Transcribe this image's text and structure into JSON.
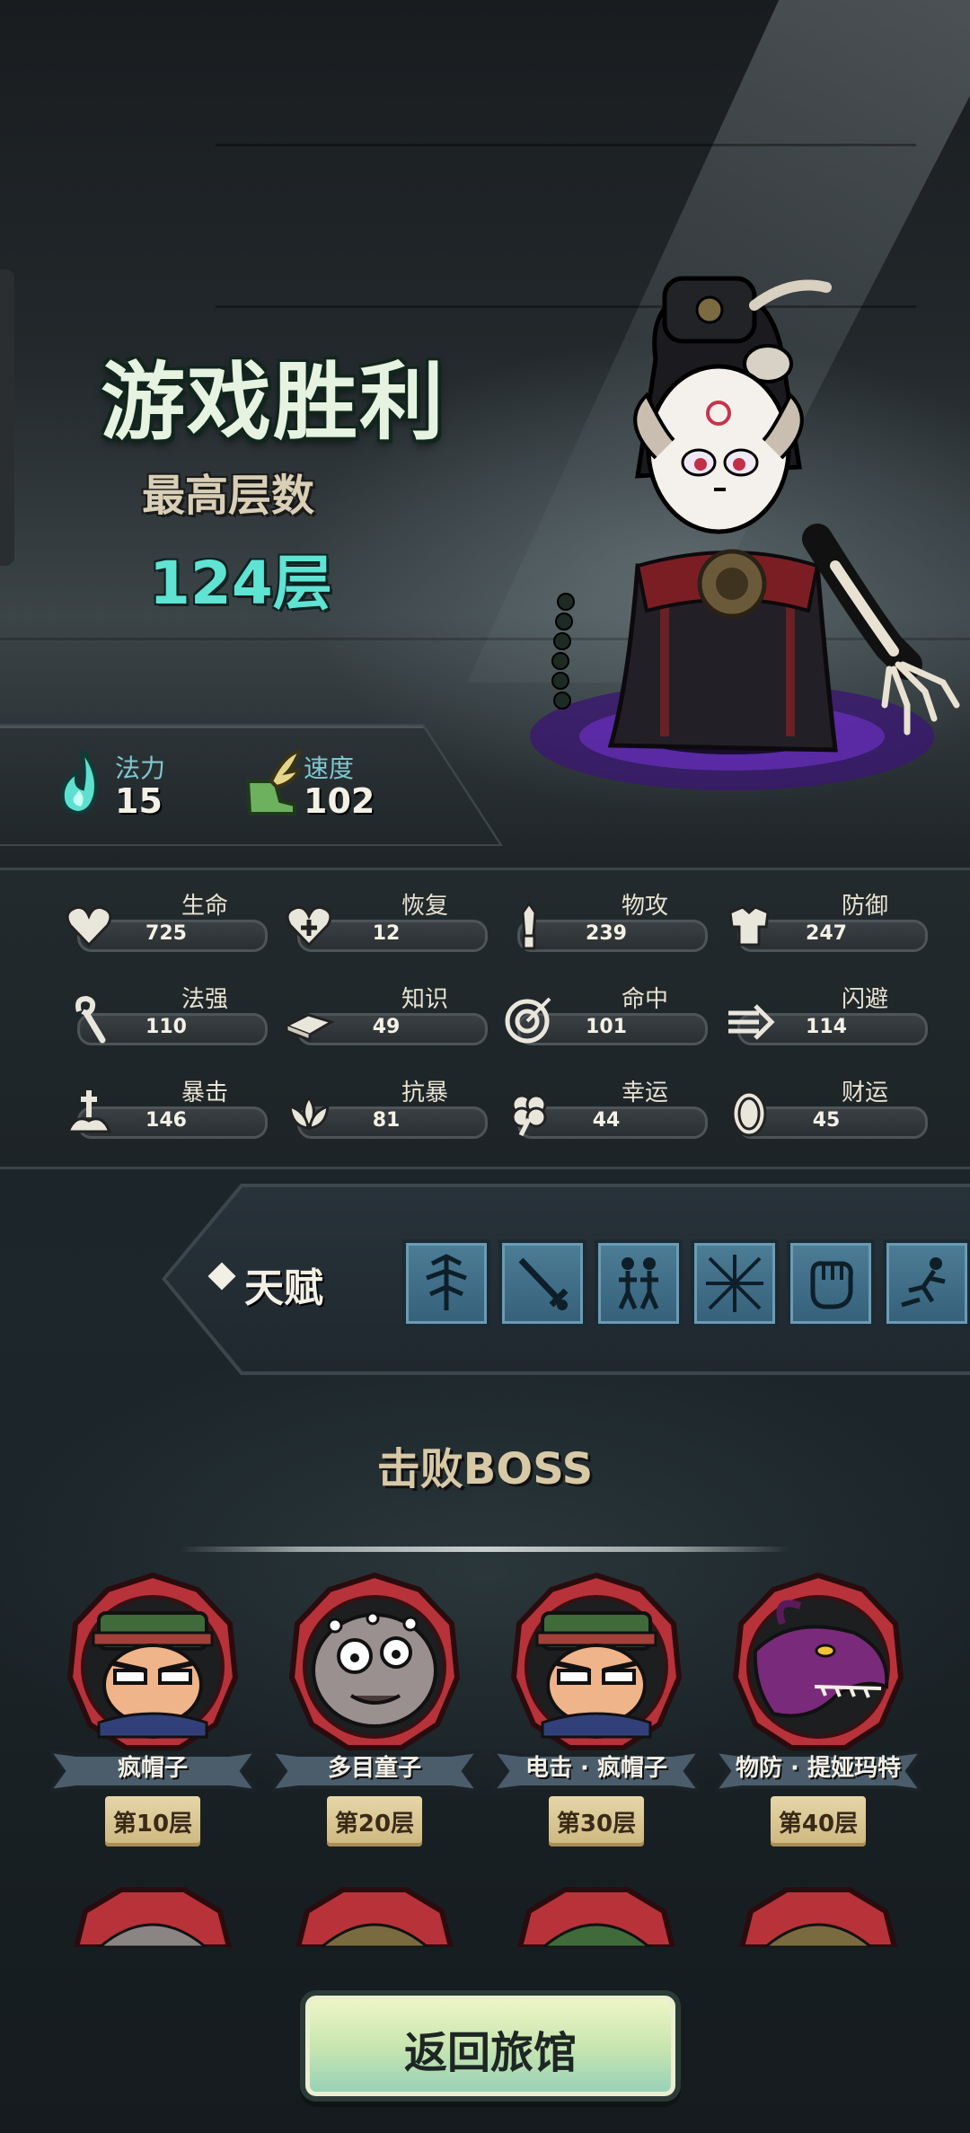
{
  "result": {
    "title": "游戏胜利",
    "floor_label": "最高层数",
    "floor_value": "124层"
  },
  "quick_stats": [
    {
      "label": "法力",
      "value": "15",
      "icon": "blue-flame-icon"
    },
    {
      "label": "速度",
      "value": "102",
      "icon": "winged-boot-icon"
    }
  ],
  "attributes": [
    {
      "name": "生命",
      "value": "725",
      "icon": "heart-icon"
    },
    {
      "name": "恢复",
      "value": "12",
      "icon": "heart-plus-icon"
    },
    {
      "name": "物攻",
      "value": "239",
      "icon": "sword-icon"
    },
    {
      "name": "防御",
      "value": "247",
      "icon": "armor-icon"
    },
    {
      "name": "法强",
      "value": "110",
      "icon": "magic-staff-icon"
    },
    {
      "name": "知识",
      "value": "49",
      "icon": "book-icon"
    },
    {
      "name": "命中",
      "value": "101",
      "icon": "target-icon"
    },
    {
      "name": "闪避",
      "value": "114",
      "icon": "dodge-arrows-icon"
    },
    {
      "name": "暴击",
      "value": "146",
      "icon": "critical-dagger-icon"
    },
    {
      "name": "抗暴",
      "value": "81",
      "icon": "lotus-shield-icon"
    },
    {
      "name": "幸运",
      "value": "44",
      "icon": "clover-icon"
    },
    {
      "name": "财运",
      "value": "45",
      "icon": "coin-icon"
    }
  ],
  "talent": {
    "label": "天赋",
    "slots": [
      "arrows-talent-icon",
      "blade-talent-icon",
      "twins-talent-icon",
      "crossed-swords-talent-icon",
      "fist-talent-icon",
      "dash-talent-icon"
    ]
  },
  "boss_section": {
    "heading": "击败BOSS",
    "bosses": [
      {
        "name": "疯帽子",
        "floor": "第10层",
        "portrait": "mad-hatter-portrait"
      },
      {
        "name": "多目童子",
        "floor": "第20层",
        "portrait": "many-eyed-child-portrait"
      },
      {
        "name": "电击 · 疯帽子",
        "floor": "第30层",
        "portrait": "mad-hatter-portrait"
      },
      {
        "name": "物防 · 提娅玛特",
        "floor": "第40层",
        "portrait": "tiamat-dragon-portrait"
      }
    ]
  },
  "return_button": {
    "label": "返回旅馆"
  },
  "colors": {
    "accent_cyan": "#5fe3d2",
    "boss_frame_red": "#b8323a",
    "talent_blue": "#4d7d96"
  }
}
